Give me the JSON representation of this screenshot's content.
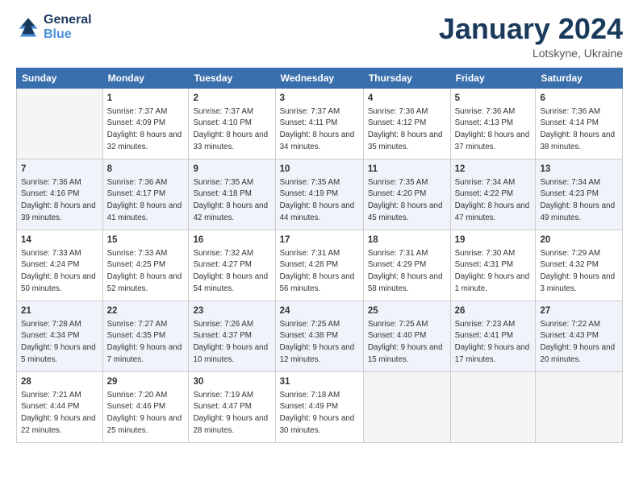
{
  "header": {
    "logo_line1": "General",
    "logo_line2": "Blue",
    "month_title": "January 2024",
    "location": "Lotskyne, Ukraine"
  },
  "weekdays": [
    "Sunday",
    "Monday",
    "Tuesday",
    "Wednesday",
    "Thursday",
    "Friday",
    "Saturday"
  ],
  "weeks": [
    [
      {
        "day": "",
        "sunrise": "",
        "sunset": "",
        "daylight": "",
        "empty": true
      },
      {
        "day": "1",
        "sunrise": "7:37 AM",
        "sunset": "4:09 PM",
        "daylight": "8 hours and 32 minutes."
      },
      {
        "day": "2",
        "sunrise": "7:37 AM",
        "sunset": "4:10 PM",
        "daylight": "8 hours and 33 minutes."
      },
      {
        "day": "3",
        "sunrise": "7:37 AM",
        "sunset": "4:11 PM",
        "daylight": "8 hours and 34 minutes."
      },
      {
        "day": "4",
        "sunrise": "7:36 AM",
        "sunset": "4:12 PM",
        "daylight": "8 hours and 35 minutes."
      },
      {
        "day": "5",
        "sunrise": "7:36 AM",
        "sunset": "4:13 PM",
        "daylight": "8 hours and 37 minutes."
      },
      {
        "day": "6",
        "sunrise": "7:36 AM",
        "sunset": "4:14 PM",
        "daylight": "8 hours and 38 minutes."
      }
    ],
    [
      {
        "day": "7",
        "sunrise": "7:36 AM",
        "sunset": "4:16 PM",
        "daylight": "8 hours and 39 minutes."
      },
      {
        "day": "8",
        "sunrise": "7:36 AM",
        "sunset": "4:17 PM",
        "daylight": "8 hours and 41 minutes."
      },
      {
        "day": "9",
        "sunrise": "7:35 AM",
        "sunset": "4:18 PM",
        "daylight": "8 hours and 42 minutes."
      },
      {
        "day": "10",
        "sunrise": "7:35 AM",
        "sunset": "4:19 PM",
        "daylight": "8 hours and 44 minutes."
      },
      {
        "day": "11",
        "sunrise": "7:35 AM",
        "sunset": "4:20 PM",
        "daylight": "8 hours and 45 minutes."
      },
      {
        "day": "12",
        "sunrise": "7:34 AM",
        "sunset": "4:22 PM",
        "daylight": "8 hours and 47 minutes."
      },
      {
        "day": "13",
        "sunrise": "7:34 AM",
        "sunset": "4:23 PM",
        "daylight": "8 hours and 49 minutes."
      }
    ],
    [
      {
        "day": "14",
        "sunrise": "7:33 AM",
        "sunset": "4:24 PM",
        "daylight": "8 hours and 50 minutes."
      },
      {
        "day": "15",
        "sunrise": "7:33 AM",
        "sunset": "4:25 PM",
        "daylight": "8 hours and 52 minutes."
      },
      {
        "day": "16",
        "sunrise": "7:32 AM",
        "sunset": "4:27 PM",
        "daylight": "8 hours and 54 minutes."
      },
      {
        "day": "17",
        "sunrise": "7:31 AM",
        "sunset": "4:28 PM",
        "daylight": "8 hours and 56 minutes."
      },
      {
        "day": "18",
        "sunrise": "7:31 AM",
        "sunset": "4:29 PM",
        "daylight": "8 hours and 58 minutes."
      },
      {
        "day": "19",
        "sunrise": "7:30 AM",
        "sunset": "4:31 PM",
        "daylight": "9 hours and 1 minute."
      },
      {
        "day": "20",
        "sunrise": "7:29 AM",
        "sunset": "4:32 PM",
        "daylight": "9 hours and 3 minutes."
      }
    ],
    [
      {
        "day": "21",
        "sunrise": "7:28 AM",
        "sunset": "4:34 PM",
        "daylight": "9 hours and 5 minutes."
      },
      {
        "day": "22",
        "sunrise": "7:27 AM",
        "sunset": "4:35 PM",
        "daylight": "9 hours and 7 minutes."
      },
      {
        "day": "23",
        "sunrise": "7:26 AM",
        "sunset": "4:37 PM",
        "daylight": "9 hours and 10 minutes."
      },
      {
        "day": "24",
        "sunrise": "7:25 AM",
        "sunset": "4:38 PM",
        "daylight": "9 hours and 12 minutes."
      },
      {
        "day": "25",
        "sunrise": "7:25 AM",
        "sunset": "4:40 PM",
        "daylight": "9 hours and 15 minutes."
      },
      {
        "day": "26",
        "sunrise": "7:23 AM",
        "sunset": "4:41 PM",
        "daylight": "9 hours and 17 minutes."
      },
      {
        "day": "27",
        "sunrise": "7:22 AM",
        "sunset": "4:43 PM",
        "daylight": "9 hours and 20 minutes."
      }
    ],
    [
      {
        "day": "28",
        "sunrise": "7:21 AM",
        "sunset": "4:44 PM",
        "daylight": "9 hours and 22 minutes."
      },
      {
        "day": "29",
        "sunrise": "7:20 AM",
        "sunset": "4:46 PM",
        "daylight": "9 hours and 25 minutes."
      },
      {
        "day": "30",
        "sunrise": "7:19 AM",
        "sunset": "4:47 PM",
        "daylight": "9 hours and 28 minutes."
      },
      {
        "day": "31",
        "sunrise": "7:18 AM",
        "sunset": "4:49 PM",
        "daylight": "9 hours and 30 minutes."
      },
      {
        "day": "",
        "sunrise": "",
        "sunset": "",
        "daylight": "",
        "empty": true
      },
      {
        "day": "",
        "sunrise": "",
        "sunset": "",
        "daylight": "",
        "empty": true
      },
      {
        "day": "",
        "sunrise": "",
        "sunset": "",
        "daylight": "",
        "empty": true
      }
    ]
  ]
}
